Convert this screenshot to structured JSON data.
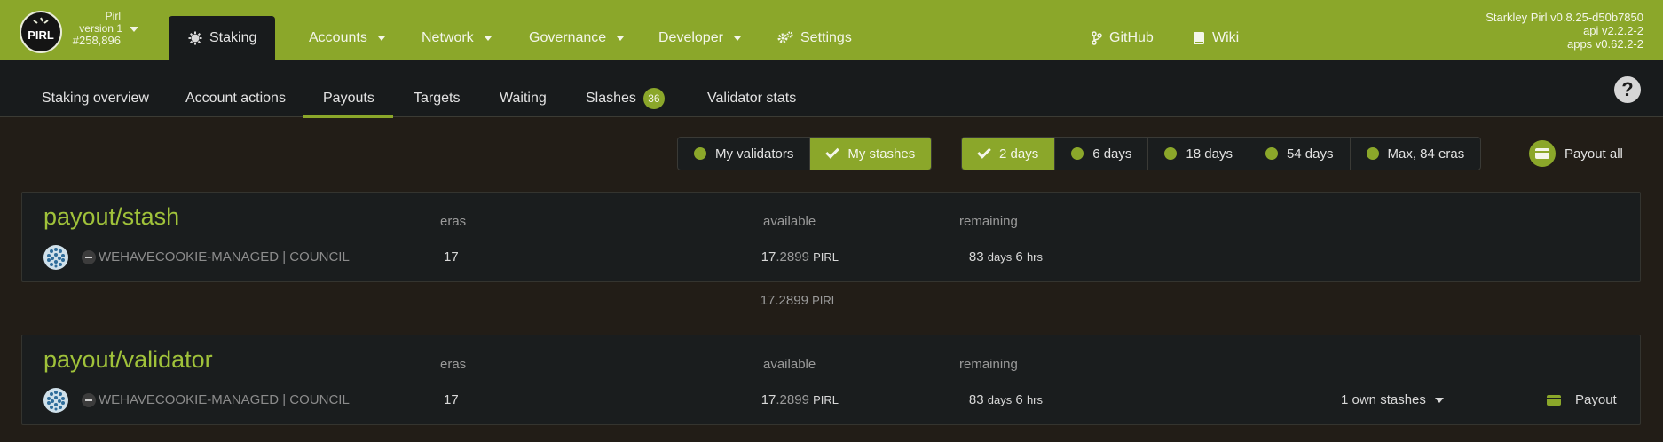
{
  "brand": {
    "logo_text": "PIRL",
    "chain_name": "Pirl",
    "version": "version 1",
    "block": "#258,896"
  },
  "nav": {
    "active": "Staking",
    "items": [
      "Accounts",
      "Network",
      "Governance",
      "Developer",
      "Settings"
    ],
    "links": [
      "GitHub",
      "Wiki"
    ]
  },
  "versions": {
    "node": "Starkley Pirl v0.8.25-d50b7850",
    "api": "api v2.2.2-2",
    "apps": "apps v0.62.2-2"
  },
  "tabs": {
    "items": [
      "Staking overview",
      "Account actions",
      "Payouts",
      "Targets",
      "Waiting",
      "Slashes",
      "Validator stats"
    ],
    "active": "Payouts",
    "slashes_count": "36"
  },
  "filters": {
    "ownership": [
      {
        "label": "My validators",
        "selected": false
      },
      {
        "label": "My stashes",
        "selected": true
      }
    ],
    "period": [
      {
        "label": "2 days",
        "selected": true
      },
      {
        "label": "6 days",
        "selected": false
      },
      {
        "label": "18 days",
        "selected": false
      },
      {
        "label": "54 days",
        "selected": false
      },
      {
        "label": "Max, 84 eras",
        "selected": false
      }
    ],
    "payout_all": "Payout all"
  },
  "stash_table": {
    "title": "payout/stash",
    "headers": {
      "eras": "eras",
      "available": "available",
      "remaining": "remaining"
    },
    "row": {
      "account": "WEHAVECOOKIE-MANAGED | COUNCIL",
      "eras": "17",
      "available_int": "17",
      "available_frac": ".2899",
      "unit": "PIRL",
      "remaining_num": "83",
      "remaining_days": "days",
      "remaining_hrs_num": "6",
      "remaining_hrs": "hrs"
    },
    "total_int": "17",
    "total_frac": ".2899",
    "total_unit": "PIRL"
  },
  "validator_table": {
    "title": "payout/validator",
    "headers": {
      "eras": "eras",
      "available": "available",
      "remaining": "remaining"
    },
    "row": {
      "account": "WEHAVECOOKIE-MANAGED | COUNCIL",
      "eras": "17",
      "available_int": "17",
      "available_frac": ".2899",
      "unit": "PIRL",
      "remaining_num": "83",
      "remaining_days": "days",
      "remaining_hrs_num": "6",
      "remaining_hrs": "hrs",
      "own_stashes": "1 own stashes",
      "payout": "Payout"
    }
  },
  "colors": {
    "accent": "#8ba72a",
    "title_green": "#a0c23a",
    "panel": "#1a1d1e",
    "background": "#221d17"
  }
}
